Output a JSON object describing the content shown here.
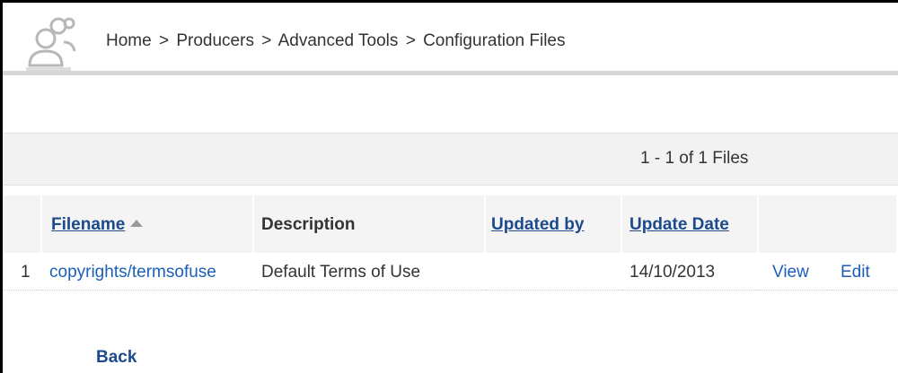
{
  "breadcrumb": {
    "items": [
      "Home",
      "Producers",
      "Advanced Tools",
      "Configuration Files"
    ],
    "separator": ">"
  },
  "pager": {
    "summary": "1 - 1 of 1 Files"
  },
  "table": {
    "columns": {
      "filename": "Filename",
      "description": "Description",
      "updated_by": "Updated by",
      "update_date": "Update Date"
    },
    "rows": [
      {
        "index": "1",
        "filename": "copyrights/termsofuse",
        "description": "Default Terms of Use",
        "updated_by": "",
        "update_date": "14/10/2013",
        "view": "View",
        "edit": "Edit"
      }
    ]
  },
  "back_label": "Back",
  "icons": {
    "logo": "users-logo-icon",
    "sort": "sort-ascending-icon"
  },
  "colors": {
    "link": "#1c5fb5",
    "header_link": "#1c4a8c",
    "border": "#000000"
  }
}
